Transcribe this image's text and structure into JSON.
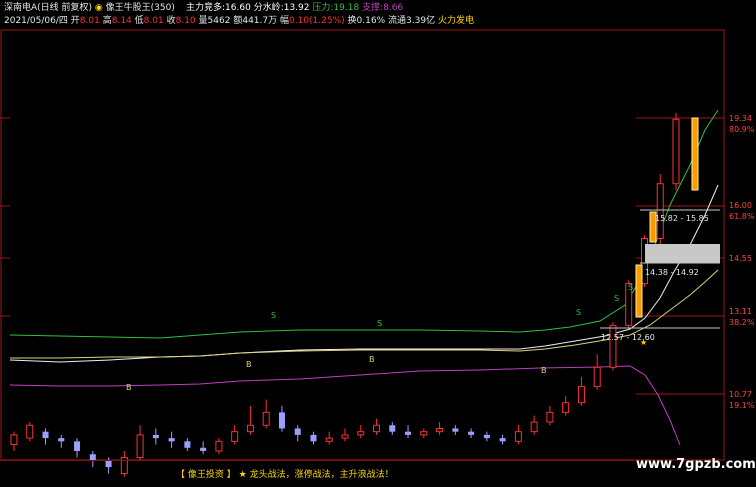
{
  "header": {
    "symbol": "深南电A(日线 前复权)",
    "indicator": "像王牛股王(350)",
    "main_force_label": "主力竞多:",
    "main_force_value": "16.60",
    "watershed_label": "分水岭:",
    "watershed_value": "13.92",
    "pressure_label": "压力:",
    "pressure_value": "19.18",
    "support_label": "支撑:",
    "support_value": "8.66"
  },
  "ohlc": {
    "date": "2021/05/06/四",
    "open_label": "开",
    "open": "8.01",
    "high_label": "高",
    "high": "8.14",
    "low_label": "低",
    "low": "8.01",
    "close_label": "收",
    "close": "8.10",
    "volume_label": "量",
    "volume": "5462",
    "amount_label": "额",
    "amount": "441.7万",
    "change_label": "幅",
    "change": "0.10(1.25%)",
    "turnover_label": "换",
    "turnover": "0.16%",
    "float_label": "流通",
    "float": "3.39亿",
    "sector": "火力发电"
  },
  "price_axis": [
    {
      "price": "19.34",
      "pct": "80.9%"
    },
    {
      "price": "16.00",
      "pct": "61.8%"
    },
    {
      "price": "14.55",
      "pct": ""
    },
    {
      "price": "13.11",
      "pct": "38.2%"
    },
    {
      "price": "10.77",
      "pct": "19.1%"
    }
  ],
  "annotations": {
    "s_mark": "S",
    "b_mark": "B",
    "star": "★",
    "zone_high": "15.82 - 15.85",
    "zone_mid": "14.38 - 14.92",
    "zone_low": "12.57 - 12.60"
  },
  "footer": {
    "brand": "【 像王投资 】",
    "star": "★",
    "slogan": "龙头战法，涨停战法，主升浪战法！"
  },
  "watermark": "www.7gpzb.com",
  "colors": {
    "up": "#ff3030",
    "down": "#9aa0ff",
    "cyan": "#40e0ff",
    "green_line": "#30c040",
    "white_line": "#f0f0f0",
    "yellow_line": "#e0d080",
    "magenta_line": "#c040c0",
    "gold_bar": "#ff9900"
  },
  "chart_data": {
    "type": "candlestick",
    "title": "",
    "y_axis_labels": [
      "19.34",
      "16.00",
      "14.55",
      "13.11",
      "10.77"
    ],
    "candles": [
      {
        "o": 9.2,
        "c": 9.5,
        "h": 9.6,
        "l": 9.0
      },
      {
        "o": 9.4,
        "c": 9.8,
        "h": 9.9,
        "l": 9.3
      },
      {
        "o": 9.6,
        "c": 9.4,
        "h": 9.7,
        "l": 9.2
      },
      {
        "o": 9.4,
        "c": 9.3,
        "h": 9.5,
        "l": 9.1
      },
      {
        "o": 9.3,
        "c": 9.0,
        "h": 9.4,
        "l": 8.8
      },
      {
        "o": 8.9,
        "c": 8.7,
        "h": 9.0,
        "l": 8.5
      },
      {
        "o": 8.7,
        "c": 8.5,
        "h": 8.8,
        "l": 8.3
      },
      {
        "o": 8.3,
        "c": 8.8,
        "h": 9.0,
        "l": 8.2
      },
      {
        "o": 8.8,
        "c": 9.5,
        "h": 9.8,
        "l": 8.7
      },
      {
        "o": 9.5,
        "c": 9.4,
        "h": 9.7,
        "l": 9.2
      },
      {
        "o": 9.4,
        "c": 9.3,
        "h": 9.6,
        "l": 9.1
      },
      {
        "o": 9.3,
        "c": 9.1,
        "h": 9.4,
        "l": 9.0
      },
      {
        "o": 9.1,
        "c": 9.0,
        "h": 9.3,
        "l": 8.9
      },
      {
        "o": 9.0,
        "c": 9.3,
        "h": 9.4,
        "l": 8.9
      },
      {
        "o": 9.3,
        "c": 9.6,
        "h": 9.8,
        "l": 9.2
      },
      {
        "o": 9.6,
        "c": 9.8,
        "h": 10.4,
        "l": 9.5
      },
      {
        "o": 9.8,
        "c": 10.2,
        "h": 10.6,
        "l": 9.7
      },
      {
        "o": 10.2,
        "c": 9.7,
        "h": 10.4,
        "l": 9.6
      },
      {
        "o": 9.7,
        "c": 9.5,
        "h": 9.8,
        "l": 9.3
      },
      {
        "o": 9.5,
        "c": 9.3,
        "h": 9.6,
        "l": 9.2
      },
      {
        "o": 9.3,
        "c": 9.4,
        "h": 9.6,
        "l": 9.2
      },
      {
        "o": 9.4,
        "c": 9.5,
        "h": 9.7,
        "l": 9.3
      },
      {
        "o": 9.5,
        "c": 9.6,
        "h": 9.8,
        "l": 9.4
      },
      {
        "o": 9.6,
        "c": 9.8,
        "h": 10.0,
        "l": 9.5
      },
      {
        "o": 9.8,
        "c": 9.6,
        "h": 9.9,
        "l": 9.5
      },
      {
        "o": 9.6,
        "c": 9.5,
        "h": 9.8,
        "l": 9.4
      },
      {
        "o": 9.5,
        "c": 9.6,
        "h": 9.7,
        "l": 9.4
      },
      {
        "o": 9.6,
        "c": 9.7,
        "h": 9.9,
        "l": 9.5
      },
      {
        "o": 9.7,
        "c": 9.6,
        "h": 9.8,
        "l": 9.5
      },
      {
        "o": 9.6,
        "c": 9.5,
        "h": 9.7,
        "l": 9.4
      },
      {
        "o": 9.5,
        "c": 9.4,
        "h": 9.6,
        "l": 9.3
      },
      {
        "o": 9.4,
        "c": 9.3,
        "h": 9.5,
        "l": 9.2
      },
      {
        "o": 9.3,
        "c": 9.6,
        "h": 9.8,
        "l": 9.2
      },
      {
        "o": 9.6,
        "c": 9.9,
        "h": 10.1,
        "l": 9.5
      },
      {
        "o": 9.9,
        "c": 10.2,
        "h": 10.4,
        "l": 9.8
      },
      {
        "o": 10.2,
        "c": 10.5,
        "h": 10.7,
        "l": 10.1
      },
      {
        "o": 10.5,
        "c": 11.0,
        "h": 11.3,
        "l": 10.4
      },
      {
        "o": 11.0,
        "c": 11.6,
        "h": 12.0,
        "l": 10.9
      },
      {
        "o": 11.6,
        "c": 12.9,
        "h": 13.0,
        "l": 11.5
      },
      {
        "o": 12.9,
        "c": 14.2,
        "h": 14.3,
        "l": 12.8
      },
      {
        "o": 14.2,
        "c": 15.6,
        "h": 15.7,
        "l": 14.1
      },
      {
        "o": 15.6,
        "c": 17.3,
        "h": 17.6,
        "l": 15.4
      },
      {
        "o": 17.3,
        "c": 19.3,
        "h": 19.5,
        "l": 17.1
      }
    ]
  }
}
